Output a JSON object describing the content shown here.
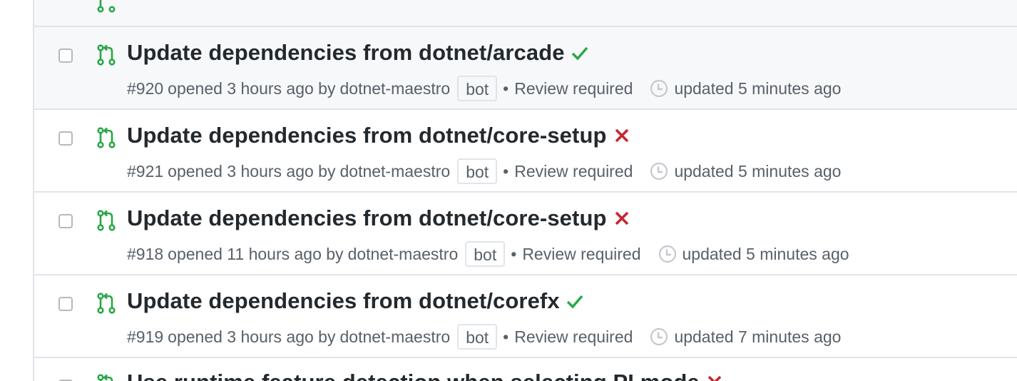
{
  "colors": {
    "open_pr": "#28a745",
    "success": "#28a745",
    "failure": "#cb2431",
    "muted_text": "#586069",
    "title_text": "#24292e",
    "border": "#e1e4e8",
    "hover_bg": "#f6f8fa"
  },
  "pull_requests": [
    {
      "title": "Update dependencies from dotnet/arcade",
      "status": "success",
      "status_icon": "check-icon",
      "number": "#920",
      "opened": "opened 3 hours ago by",
      "author": "dotnet-maestro",
      "label": "bot",
      "review": "Review required",
      "updated": "updated 5 minutes ago"
    },
    {
      "title": "Update dependencies from dotnet/core-setup",
      "status": "failure",
      "status_icon": "x-icon",
      "number": "#921",
      "opened": "opened 3 hours ago by",
      "author": "dotnet-maestro",
      "label": "bot",
      "review": "Review required",
      "updated": "updated 5 minutes ago"
    },
    {
      "title": "Update dependencies from dotnet/core-setup",
      "status": "failure",
      "status_icon": "x-icon",
      "number": "#918",
      "opened": "opened 11 hours ago by",
      "author": "dotnet-maestro",
      "label": "bot",
      "review": "Review required",
      "updated": "updated 5 minutes ago"
    },
    {
      "title": "Update dependencies from dotnet/corefx",
      "status": "success",
      "status_icon": "check-icon",
      "number": "#919",
      "opened": "opened 3 hours ago by",
      "author": "dotnet-maestro",
      "label": "bot",
      "review": "Review required",
      "updated": "updated 7 minutes ago"
    },
    {
      "title": "Use runtime feature detection when selecting PI mode",
      "status": "failure",
      "status_icon": "x-icon"
    }
  ]
}
